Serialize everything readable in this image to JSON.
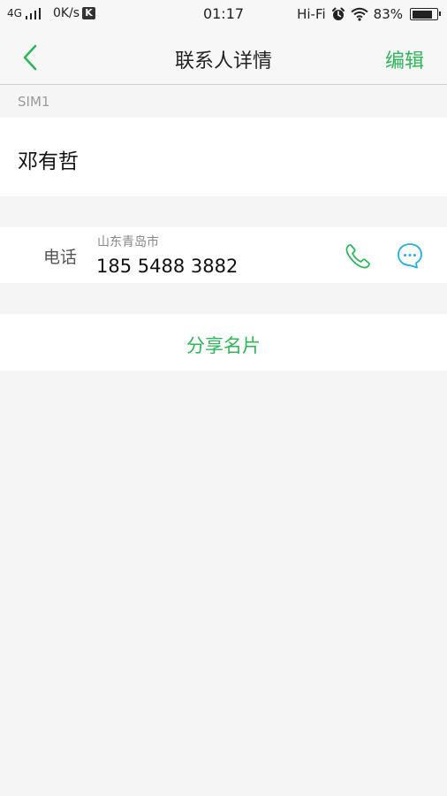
{
  "status_bar": {
    "network": "4G",
    "speed": "0K/s",
    "k_badge": "K",
    "time": "01:17",
    "hifi": "Hi-Fi",
    "battery_text": "83%",
    "battery_level": 0.83
  },
  "nav": {
    "title": "联系人详情",
    "edit_label": "编辑"
  },
  "sim_label": "SIM1",
  "contact": {
    "name": "邓有哲"
  },
  "phone": {
    "label": "电话",
    "location": "山东青岛市",
    "number": "185 5488 3882"
  },
  "share_label": "分享名片",
  "colors": {
    "accent_green": "#2fb55a",
    "message_blue": "#22aee0"
  },
  "icons": {
    "back": "chevron-left-icon",
    "call": "phone-icon",
    "message": "chat-bubble-icon",
    "alarm": "alarm-clock-icon",
    "wifi": "wifi-icon",
    "battery": "battery-icon",
    "signal": "signal-icon"
  }
}
